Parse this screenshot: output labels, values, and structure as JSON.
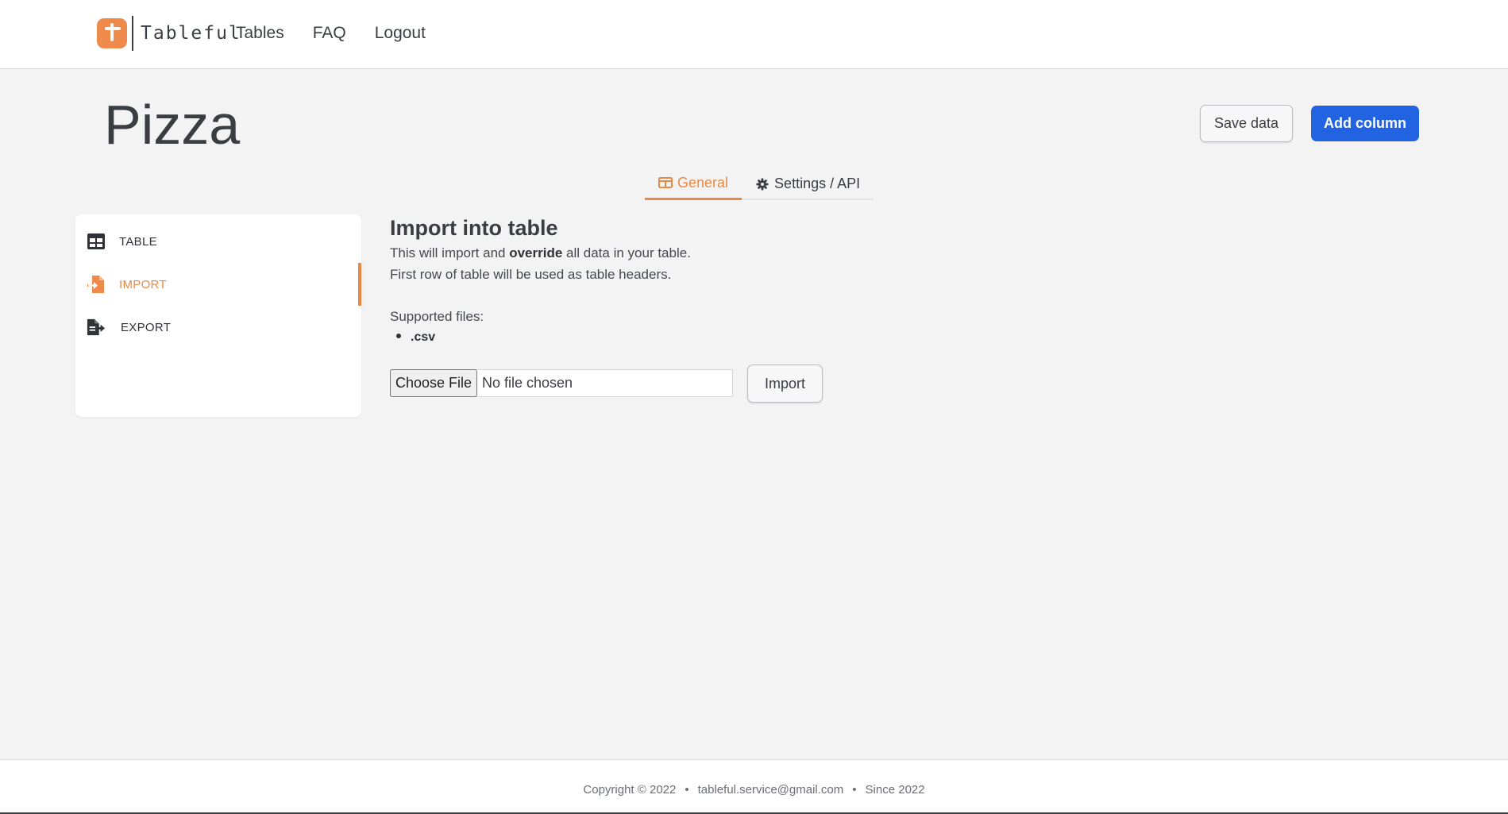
{
  "brand": {
    "name": "Tableful",
    "logo_color": "#ef8a4d"
  },
  "nav": {
    "links": [
      "Tables",
      "FAQ",
      "Logout"
    ]
  },
  "header": {
    "title": "Pizza",
    "save_label": "Save data",
    "add_label": "Add column"
  },
  "tabs": [
    {
      "label": "General",
      "icon": "table-icon",
      "active": true
    },
    {
      "label": "Settings / API",
      "icon": "gear-icon",
      "active": false
    }
  ],
  "sidebar": {
    "items": [
      {
        "label": "TABLE",
        "icon": "table-grid-icon",
        "active": false
      },
      {
        "label": "IMPORT",
        "icon": "file-import-icon",
        "active": true
      },
      {
        "label": "EXPORT",
        "icon": "file-export-icon",
        "active": false
      }
    ]
  },
  "import": {
    "heading": "Import into table",
    "line1_before": "This will import and ",
    "line1_bold": "override",
    "line1_after": " all data in your table.",
    "line2": "First row of table will be used as table headers.",
    "supported_label": "Supported files:",
    "file_types": [
      ".csv"
    ],
    "choose_label": "Choose File",
    "file_status": "No file chosen",
    "import_label": "Import"
  },
  "footer": {
    "copyright": "Copyright © 2022",
    "email": "tableful.service@gmail.com",
    "since": "Since 2022"
  },
  "colors": {
    "accent": "#e78a45",
    "primary": "#2263e2",
    "background": "#f3f3f4"
  }
}
